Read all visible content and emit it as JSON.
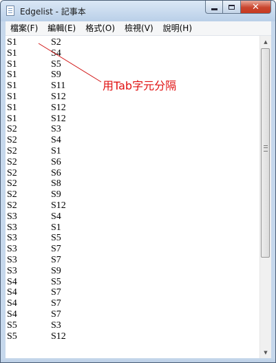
{
  "window": {
    "title": "Edgelist - 記事本"
  },
  "menu": [
    "檔案(F)",
    "編輯(E)",
    "格式(O)",
    "檢視(V)",
    "說明(H)"
  ],
  "rows": [
    [
      "S1",
      "S2"
    ],
    [
      "S1",
      "S4"
    ],
    [
      "S1",
      "S5"
    ],
    [
      "S1",
      "S9"
    ],
    [
      "S1",
      "S11"
    ],
    [
      "S1",
      "S12"
    ],
    [
      "S1",
      "S12"
    ],
    [
      "S1",
      "S12"
    ],
    [
      "S2",
      "S3"
    ],
    [
      "S2",
      "S4"
    ],
    [
      "S2",
      "S1"
    ],
    [
      "S2",
      "S6"
    ],
    [
      "S2",
      "S6"
    ],
    [
      "S2",
      "S8"
    ],
    [
      "S2",
      "S9"
    ],
    [
      "S2",
      "S12"
    ],
    [
      "S3",
      "S4"
    ],
    [
      "S3",
      "S1"
    ],
    [
      "S3",
      "S5"
    ],
    [
      "S3",
      "S7"
    ],
    [
      "S3",
      "S7"
    ],
    [
      "S3",
      "S9"
    ],
    [
      "S4",
      "S5"
    ],
    [
      "S4",
      "S7"
    ],
    [
      "S4",
      "S7"
    ],
    [
      "S4",
      "S7"
    ],
    [
      "S5",
      "S3"
    ],
    [
      "S5",
      "S12"
    ]
  ],
  "annotation": {
    "text": "用Tab字元分隔",
    "color": "#e01010"
  },
  "colors": {
    "frame": "#c6d8ec",
    "close": "#c73a22"
  }
}
